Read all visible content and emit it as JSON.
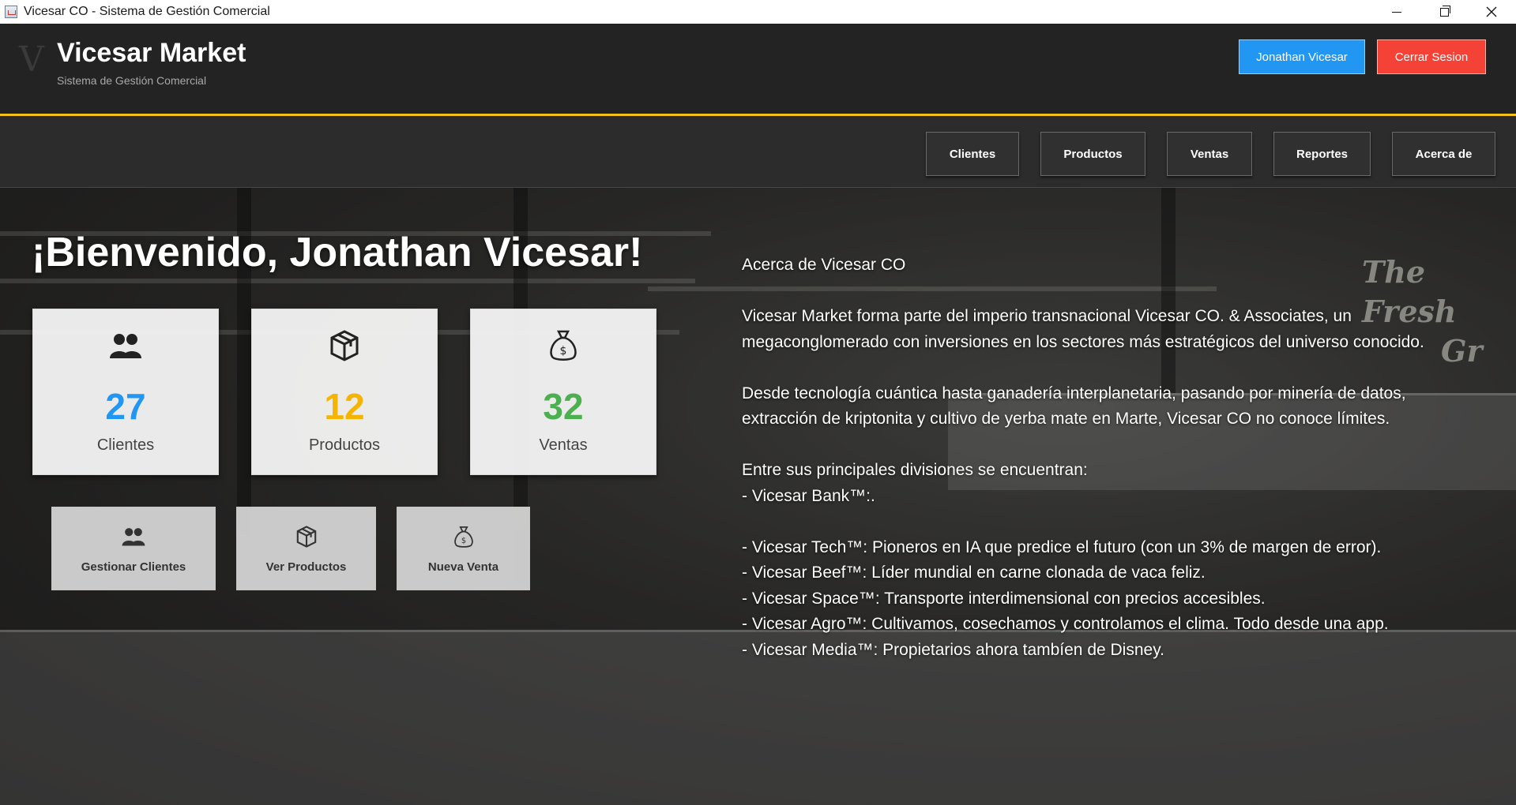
{
  "window": {
    "title": "Vicesar CO - Sistema de Gestión Comercial"
  },
  "header": {
    "logo_letter": "V",
    "brand_name": "Vicesar Market",
    "brand_subtitle": "Sistema de Gestión Comercial",
    "user_button": "Jonathan Vicesar",
    "logout_button": "Cerrar Sesion",
    "accent_color": "#f2c21b",
    "user_button_color": "#2196f3",
    "logout_button_color": "#f44336"
  },
  "nav": {
    "items": [
      {
        "label": "Clientes"
      },
      {
        "label": "Productos"
      },
      {
        "label": "Ventas"
      },
      {
        "label": "Reportes"
      },
      {
        "label": "Acerca de"
      }
    ]
  },
  "main": {
    "welcome": "¡Bienvenido, Jonathan Vicesar!",
    "stats": [
      {
        "value": "27",
        "label": "Clientes",
        "icon": "users-icon",
        "color": "#2196f3"
      },
      {
        "value": "12",
        "label": "Productos",
        "icon": "box-icon",
        "color": "#f5b400"
      },
      {
        "value": "32",
        "label": "Ventas",
        "icon": "money-bag-icon",
        "color": "#4caf50"
      }
    ],
    "actions": [
      {
        "label": "Gestionar Clientes",
        "icon": "users-icon"
      },
      {
        "label": "Ver Productos",
        "icon": "box-icon"
      },
      {
        "label": "Nueva Venta",
        "icon": "money-bag-icon"
      }
    ],
    "background_sign": "The Fresh Gr"
  },
  "about": {
    "title": "Acerca de Vicesar CO",
    "paragraph1": "Vicesar Market forma parte del imperio transnacional Vicesar CO. & Associates, un megaconglomerado con inversiones en los sectores más estratégicos del universo conocido.",
    "paragraph2": "Desde tecnología cuántica hasta ganadería interplanetaria, pasando por minería de datos, extracción de kriptonita y cultivo de yerba mate en Marte, Vicesar CO no conoce límites.",
    "divisions_intro": "Entre sus principales divisiones se encuentran:",
    "division_bank": "- Vicesar Bank™:.",
    "divisions": [
      "- Vicesar Tech™: Pioneros en IA que predice el futuro (con un 3% de margen de error).",
      "- Vicesar Beef™: Líder mundial en carne clonada de vaca feliz.",
      "- Vicesar Space™: Transporte interdimensional con precios accesibles.",
      "- Vicesar Agro™: Cultivamos, cosechamos y controlamos el clima. Todo desde una app.",
      "- Vicesar Media™: Propietarios ahora tambíen de Disney."
    ]
  }
}
